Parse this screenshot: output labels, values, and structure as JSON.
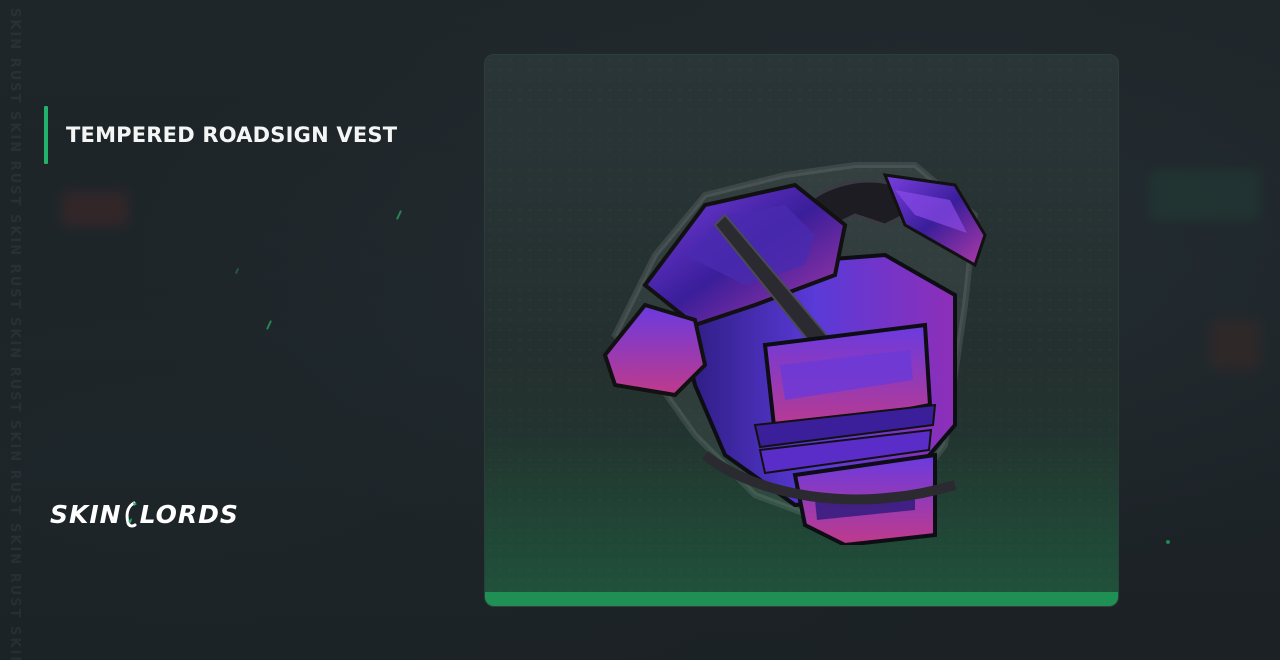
{
  "item": {
    "name": "TEMPERED ROADSIGN VEST"
  },
  "brand": {
    "logo_text_left": "SKIN",
    "logo_text_right": "LORDS"
  },
  "watermark": {
    "text": "SKIN RUST SKIN RUST SKIN RUST SKIN RUST SKIN RUST SKIN RUST SKIN RUST SKIN RUST SKIN RUST SKIN RUST"
  },
  "colors": {
    "accent": "#22b26a",
    "background": "#1e2428",
    "card_bar": "#1f8f54",
    "vest_primary": "#5a2cc8",
    "vest_secondary": "#8a3bd6"
  },
  "icons": {
    "logo_mark": "leaf-hook-icon"
  }
}
